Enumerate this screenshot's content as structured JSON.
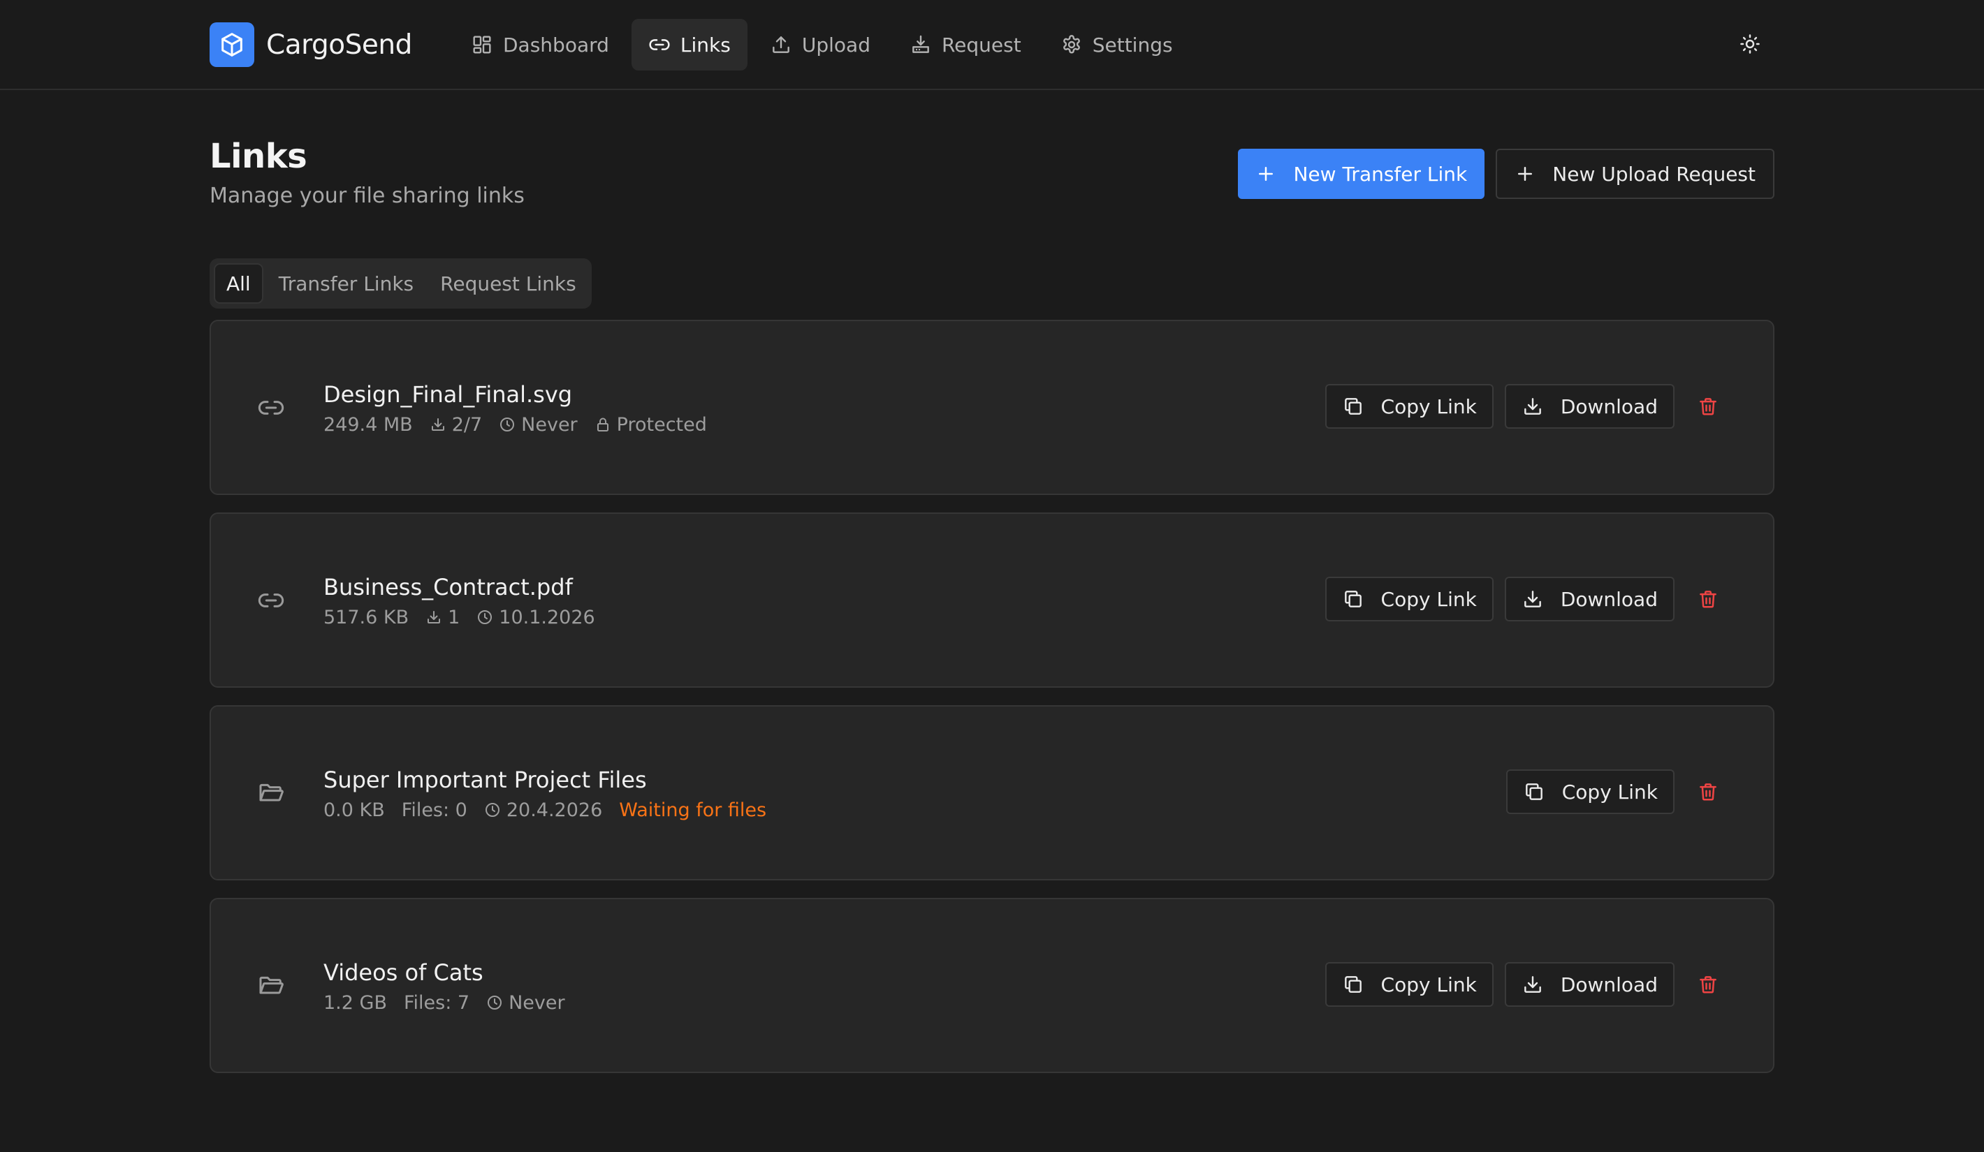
{
  "colors": {
    "background": "#1b1b1b",
    "card": "#262626",
    "accent": "#3b82f6",
    "warning": "#f97316",
    "danger": "#ef4444"
  },
  "app": {
    "name": "CargoSend",
    "logo_icon": "cube-icon"
  },
  "nav": [
    {
      "label": "Dashboard",
      "icon": "dashboard-icon",
      "active": false
    },
    {
      "label": "Links",
      "icon": "link-icon",
      "active": true
    },
    {
      "label": "Upload",
      "icon": "upload-icon",
      "active": false
    },
    {
      "label": "Request",
      "icon": "inbox-download-icon",
      "active": false
    },
    {
      "label": "Settings",
      "icon": "gear-icon",
      "active": false
    }
  ],
  "theme_toggle": {
    "icon": "sun-icon"
  },
  "page": {
    "title": "Links",
    "subtitle": "Manage your file sharing links",
    "new_transfer_label": "New Transfer Link",
    "new_request_label": "New Upload Request"
  },
  "tabs": [
    {
      "label": "All",
      "active": true
    },
    {
      "label": "Transfer Links",
      "active": false
    },
    {
      "label": "Request Links",
      "active": false
    }
  ],
  "actions": {
    "copy_label": "Copy Link",
    "download_label": "Download"
  },
  "links": [
    {
      "type": "transfer",
      "icon": "link-icon",
      "name": "Design_Final_Final.svg",
      "size": "249.4 MB",
      "downloads": "2/7",
      "expires": "Never",
      "protected_label": "Protected",
      "can_download": true
    },
    {
      "type": "transfer",
      "icon": "link-icon",
      "name": "Business_Contract.pdf",
      "size": "517.6 KB",
      "downloads": "1",
      "expires": "10.1.2026",
      "can_download": true
    },
    {
      "type": "request",
      "icon": "folder-open-icon",
      "name": "Super Important Project Files",
      "size": "0.0 KB",
      "files": "Files: 0",
      "expires": "20.4.2026",
      "status": "Waiting for files",
      "can_download": false
    },
    {
      "type": "request",
      "icon": "folder-open-icon",
      "name": "Videos of Cats",
      "size": "1.2 GB",
      "files": "Files: 7",
      "expires": "Never",
      "can_download": true
    }
  ]
}
